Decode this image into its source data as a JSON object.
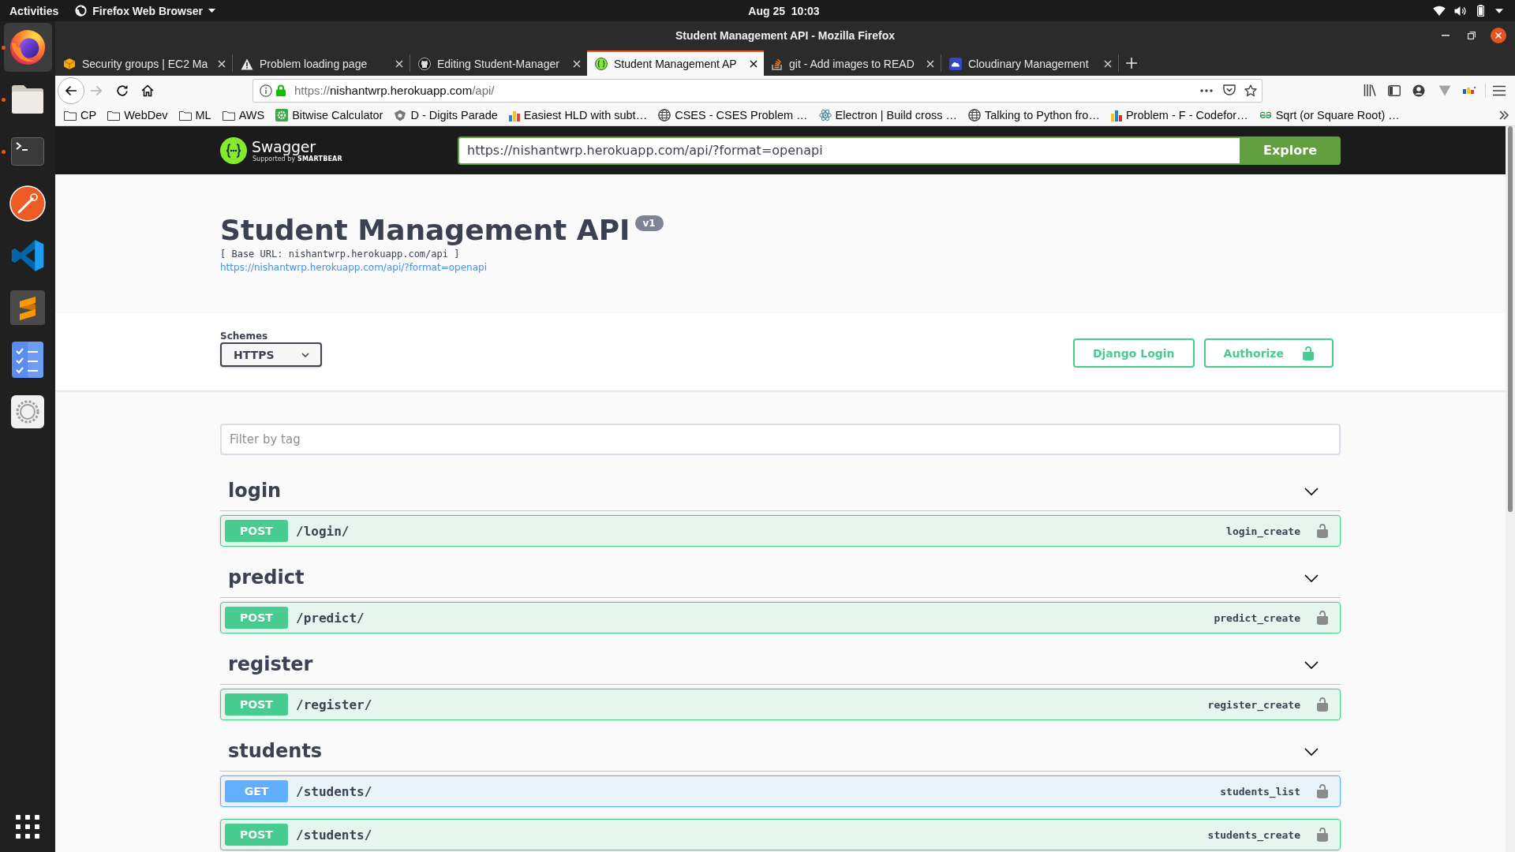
{
  "top_bar": {
    "activities": "Activities",
    "app_menu": "Firefox Web Browser",
    "clock": "Aug 25  10:03"
  },
  "dock": {
    "items": [
      {
        "running": true,
        "selected": true
      },
      {
        "running": true,
        "selected": false
      },
      {
        "running": true,
        "selected": false
      },
      {
        "running": false,
        "selected": false
      },
      {
        "running": false,
        "selected": false
      },
      {
        "running": false,
        "selected": false
      },
      {
        "running": false,
        "selected": false
      },
      {
        "running": false,
        "selected": false
      }
    ]
  },
  "window": {
    "title": "Student Management API - Mozilla Firefox"
  },
  "tabs": [
    {
      "label": "Security groups | EC2 Ma",
      "selected": false
    },
    {
      "label": "Problem loading page",
      "selected": false
    },
    {
      "label": "Editing Student-Manager",
      "selected": false
    },
    {
      "label": "Student Management AP",
      "selected": true
    },
    {
      "label": "git - Add images to READ",
      "selected": false
    },
    {
      "label": "Cloudinary Management",
      "selected": false
    }
  ],
  "toolbar": {
    "buttons": [
      {
        "kind": "back",
        "disabled": false
      },
      {
        "kind": "forward",
        "disabled": true
      },
      {
        "kind": "reload",
        "disabled": false
      },
      {
        "kind": "home",
        "disabled": false
      }
    ],
    "url": "https://nishantwrp.herokuapp.com/api/"
  },
  "bookmarks": [
    {
      "kind": "folder",
      "label": "CP"
    },
    {
      "kind": "folder",
      "label": "WebDev"
    },
    {
      "kind": "folder",
      "label": "ML"
    },
    {
      "kind": "folder",
      "label": "AWS"
    },
    {
      "kind": "site",
      "label": "Bitwise Calculator"
    },
    {
      "kind": "site",
      "label": "D - Digits Parade"
    },
    {
      "kind": "site",
      "label": "Easiest HLD with subt…"
    },
    {
      "kind": "site",
      "label": "CSES - CSES Problem …"
    },
    {
      "kind": "site",
      "label": "Electron | Build cross …"
    },
    {
      "kind": "site",
      "label": "Talking to Python fro…"
    },
    {
      "kind": "site",
      "label": "Problem - F - Codefor…"
    },
    {
      "kind": "site",
      "label": "Sqrt (or Square Root) …"
    }
  ],
  "swagger": {
    "logo": {
      "name": "Swagger",
      "tagline": "Supported by",
      "brand": "SMARTBEAR"
    },
    "spec_url": "https://nishantwrp.herokuapp.com/api/?format=openapi",
    "explore": "Explore"
  },
  "info": {
    "title": "Student Management API",
    "version": "v1",
    "base_url": "[ Base URL: nishantwrp.herokuapp.com/api ]",
    "spec_link": "https://nishantwrp.herokuapp.com/api/?format=openapi"
  },
  "schemes": {
    "label": "Schemes",
    "value": "HTTPS"
  },
  "auth_buttons": [
    {
      "kind": "login",
      "label": "Django Login"
    },
    {
      "kind": "authorize",
      "label": "Authorize"
    }
  ],
  "filter": {
    "placeholder": "Filter by tag"
  },
  "tags": [
    {
      "name": "login",
      "expanded": true,
      "operations": [
        {
          "kind": "post",
          "method": "POST",
          "path": "/login/",
          "operation_id": "login_create"
        }
      ]
    },
    {
      "name": "predict",
      "expanded": true,
      "operations": [
        {
          "kind": "post",
          "method": "POST",
          "path": "/predict/",
          "operation_id": "predict_create"
        }
      ]
    },
    {
      "name": "register",
      "expanded": true,
      "operations": [
        {
          "kind": "post",
          "method": "POST",
          "path": "/register/",
          "operation_id": "register_create"
        }
      ]
    },
    {
      "name": "students",
      "expanded": true,
      "operations": [
        {
          "kind": "get",
          "method": "GET",
          "path": "/students/",
          "operation_id": "students_list"
        },
        {
          "kind": "post",
          "method": "POST",
          "path": "/students/",
          "operation_id": "students_create"
        }
      ]
    }
  ]
}
